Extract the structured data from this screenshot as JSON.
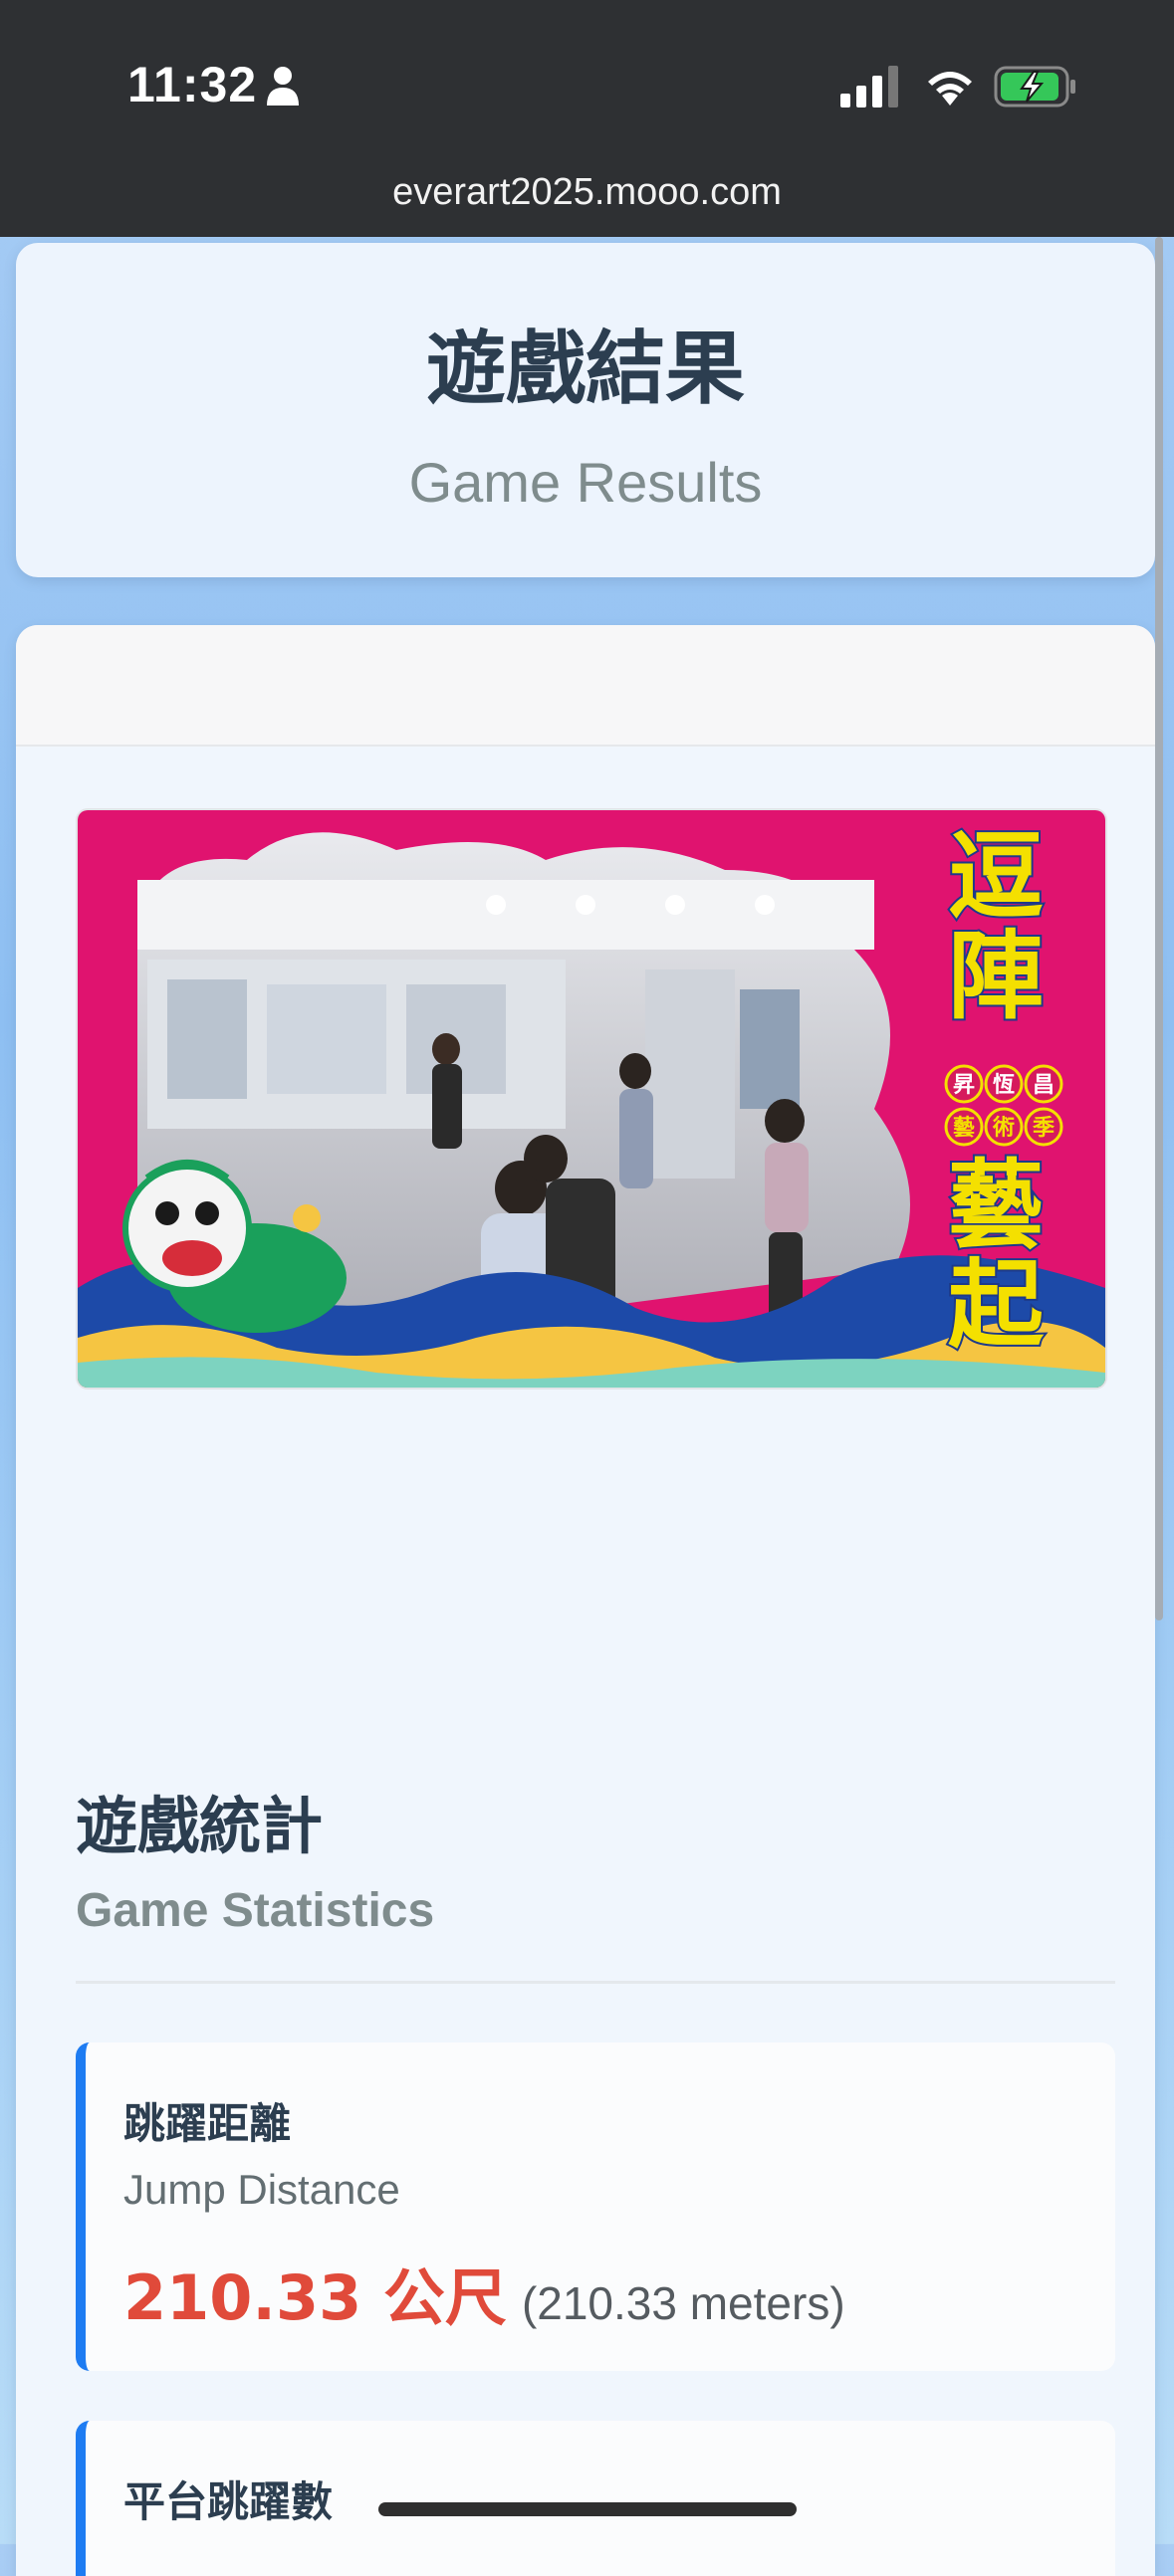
{
  "status_bar": {
    "time": "11:32",
    "url": "everart2025.mooo.com"
  },
  "header": {
    "title_zh": "遊戲結果",
    "title_en": "Game Results"
  },
  "photo": {
    "banner_text": [
      "逗",
      "陣",
      "藝",
      "起"
    ],
    "badge_top": [
      "昇",
      "恆",
      "昌"
    ],
    "badge_bottom": [
      "藝",
      "術",
      "季"
    ]
  },
  "statistics": {
    "title_zh": "遊戲統計",
    "title_en": "Game Statistics",
    "items": [
      {
        "label_zh": "跳躍距離",
        "label_en": "Jump Distance",
        "value": "210.33 公尺",
        "note": "(210.33 meters)"
      },
      {
        "label_zh": "平台跳躍數"
      }
    ]
  },
  "colors": {
    "accent": "#1e7cf2",
    "value_red": "#e04a3a",
    "photo_frame": "#e0136f",
    "banner_yellow": "#f4e000"
  }
}
